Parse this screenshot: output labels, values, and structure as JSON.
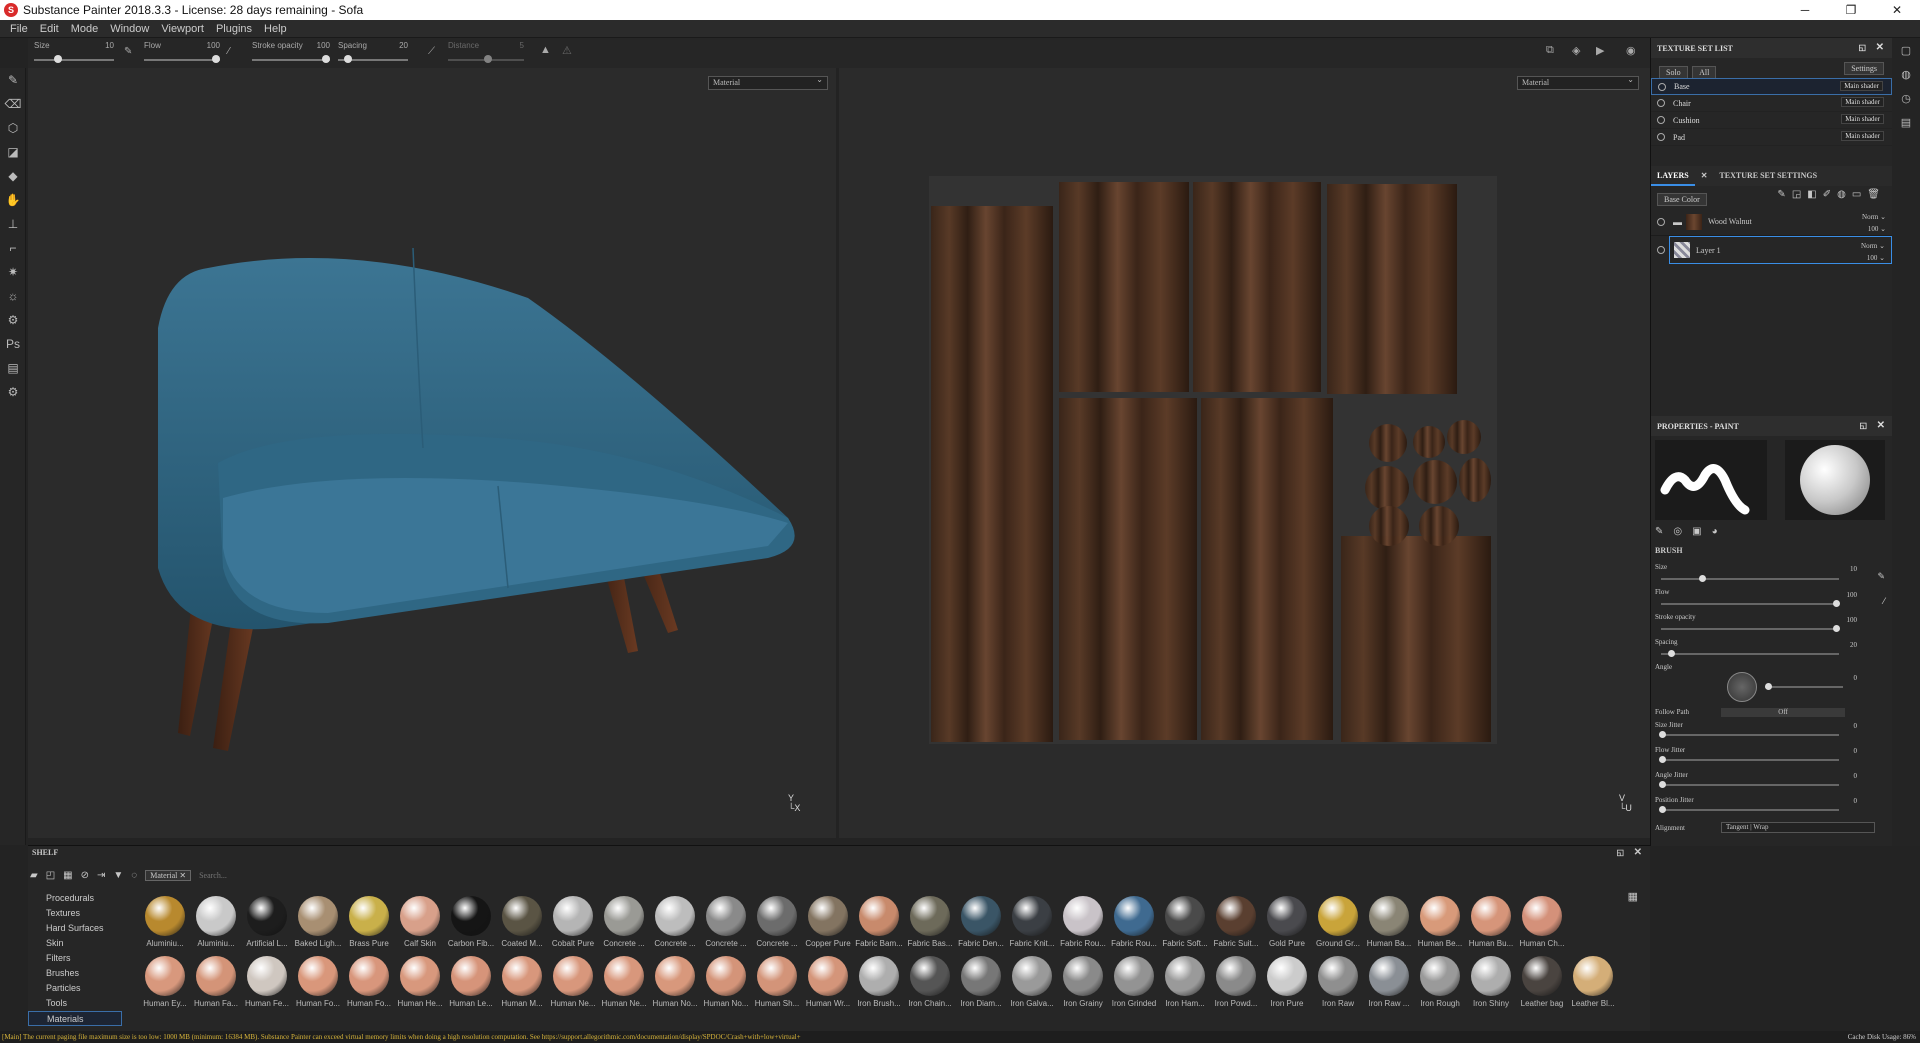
{
  "window": {
    "title": "Substance Painter 2018.3.3 - License: 28 days remaining - Sofa",
    "logo": "S"
  },
  "menu": [
    "File",
    "Edit",
    "Mode",
    "Window",
    "Viewport",
    "Plugins",
    "Help"
  ],
  "toolbar": {
    "size_label": "Size",
    "size_value": "10",
    "flow_label": "Flow",
    "flow_value": "100",
    "stroke_label": "Stroke opacity",
    "stroke_value": "100",
    "spacing_label": "Spacing",
    "spacing_value": "20",
    "distance_label": "Distance",
    "distance_value": "5"
  },
  "viewport": {
    "left_select": "Material",
    "right_select": "Material"
  },
  "texture_set_list": {
    "title": "TEXTURE SET LIST",
    "solo": "Solo",
    "all": "All",
    "settings": "Settings",
    "rows": [
      {
        "name": "Base",
        "shader": "Main shader"
      },
      {
        "name": "Chair",
        "shader": "Main shader"
      },
      {
        "name": "Cushion",
        "shader": "Main shader"
      },
      {
        "name": "Pad",
        "shader": "Main shader"
      }
    ]
  },
  "layers": {
    "tab_layers": "LAYERS",
    "tab_settings": "TEXTURE SET SETTINGS",
    "channel": "Base Color",
    "items": [
      {
        "name": "Wood Walnut",
        "blend": "Norm",
        "opacity": "100"
      },
      {
        "name": "Layer 1",
        "blend": "Norm",
        "opacity": "100"
      }
    ]
  },
  "properties": {
    "title": "PROPERTIES - PAINT",
    "section": "BRUSH",
    "size_label": "Size",
    "size_value": "10",
    "size_pct": 0.22,
    "flow_label": "Flow",
    "flow_value": "100",
    "flow_pct": 1.0,
    "stroke_label": "Stroke opacity",
    "stroke_value": "100",
    "stroke_pct": 1.0,
    "spacing_label": "Spacing",
    "spacing_value": "20",
    "spacing_pct": 0.04,
    "angle_label": "Angle",
    "angle_value": "0",
    "follow_label": "Follow Path",
    "follow_value": "Off",
    "size_jitter_label": "Size Jitter",
    "size_jitter_value": "0",
    "flow_jitter_label": "Flow Jitter",
    "flow_jitter_value": "0",
    "angle_jitter_label": "Angle Jitter",
    "angle_jitter_value": "0",
    "position_jitter_label": "Position Jitter",
    "position_jitter_value": "0",
    "alignment_label": "Alignment",
    "alignment_value": "Tangent | Wrap"
  },
  "shelf": {
    "title": "SHELF",
    "filter_tag": "Material",
    "search_placeholder": "Search...",
    "categories": [
      "Procedurals",
      "Textures",
      "Hard Surfaces",
      "Skin",
      "Filters",
      "Brushes",
      "Particles",
      "Tools",
      "Materials"
    ],
    "active_category": "Materials",
    "materials_row1": [
      "Aluminiu...",
      "Aluminiu...",
      "Artificial L...",
      "Baked Ligh...",
      "Brass Pure",
      "Calf Skin",
      "Carbon Fib...",
      "Coated M...",
      "Cobalt Pure",
      "Concrete ...",
      "Concrete ...",
      "Concrete ...",
      "Concrete ...",
      "Copper Pure",
      "Fabric Bam...",
      "Fabric Bas...",
      "Fabric Den...",
      "Fabric Knit...",
      "Fabric Rou...",
      "Fabric Rou...",
      "Fabric Soft...",
      "Fabric Suit...",
      "Gold Pure",
      "Ground Gr...",
      "Human Ba...",
      "Human Be...",
      "Human Bu...",
      "Human Ch..."
    ],
    "materials_row2": [
      "Human Ey...",
      "Human Fa...",
      "Human Fe...",
      "Human Fo...",
      "Human Fo...",
      "Human He...",
      "Human Le...",
      "Human M...",
      "Human Ne...",
      "Human Ne...",
      "Human No...",
      "Human No...",
      "Human Sh...",
      "Human Wr...",
      "Iron Brush...",
      "Iron Chain...",
      "Iron Diam...",
      "Iron Galva...",
      "Iron Grainy",
      "Iron Grinded",
      "Iron Ham...",
      "Iron Powd...",
      "Iron Pure",
      "Iron Raw",
      "Iron Raw ...",
      "Iron Rough",
      "Iron Shiny",
      "Leather bag",
      "Leather Bl..."
    ],
    "colors_row1": [
      "#b8892e",
      "#c9c9c9",
      "#1d1d1d",
      "#a88f72",
      "#c9b04a",
      "#d8a08a",
      "#151515",
      "#5a5444",
      "#b5b5b5",
      "#9a9a95",
      "#bdbdbd",
      "#8a8a8a",
      "#6c6c6c",
      "#837461",
      "#c88a6c",
      "#6d6a5a",
      "#3a5566",
      "#3b3f44",
      "#c9c3c8",
      "#3f6a90",
      "#4a4a4a",
      "#5a3f30",
      "#4a4a4e",
      "#c9a43a",
      "#8a8575",
      "#d89a7a",
      "#d6957a",
      "#d4917a",
      "#d8987d"
    ],
    "colors_row2": [
      "#d8987d",
      "#d49478",
      "#cfc7c0",
      "#d9977b",
      "#d8967c",
      "#d8987d",
      "#d6947a",
      "#d8977c",
      "#d8977c",
      "#d8977c",
      "#d8987c",
      "#d49479",
      "#d39479",
      "#d4957a",
      "#aeaeae",
      "#555555",
      "#777777",
      "#9a9a9a",
      "#8a8a8a",
      "#939393",
      "#9a9a9a",
      "#8a8a8a",
      "#cccccc",
      "#8f8f8f",
      "#8a8f95",
      "#9a9a9a",
      "#aeaeae",
      "#4a4440",
      "#d4ae78"
    ]
  },
  "status": {
    "message": "[Main] The current paging file maximum size is too low: 1000 MB (minimum: 16384 MB). Substance Painter can exceed virtual memory limits when doing a high resolution computation. See https://support.allegorithmic.com/documentation/display/SPDOC/Crash+with+low+virtual+",
    "cache": "Cache Disk Usage:   86%"
  }
}
